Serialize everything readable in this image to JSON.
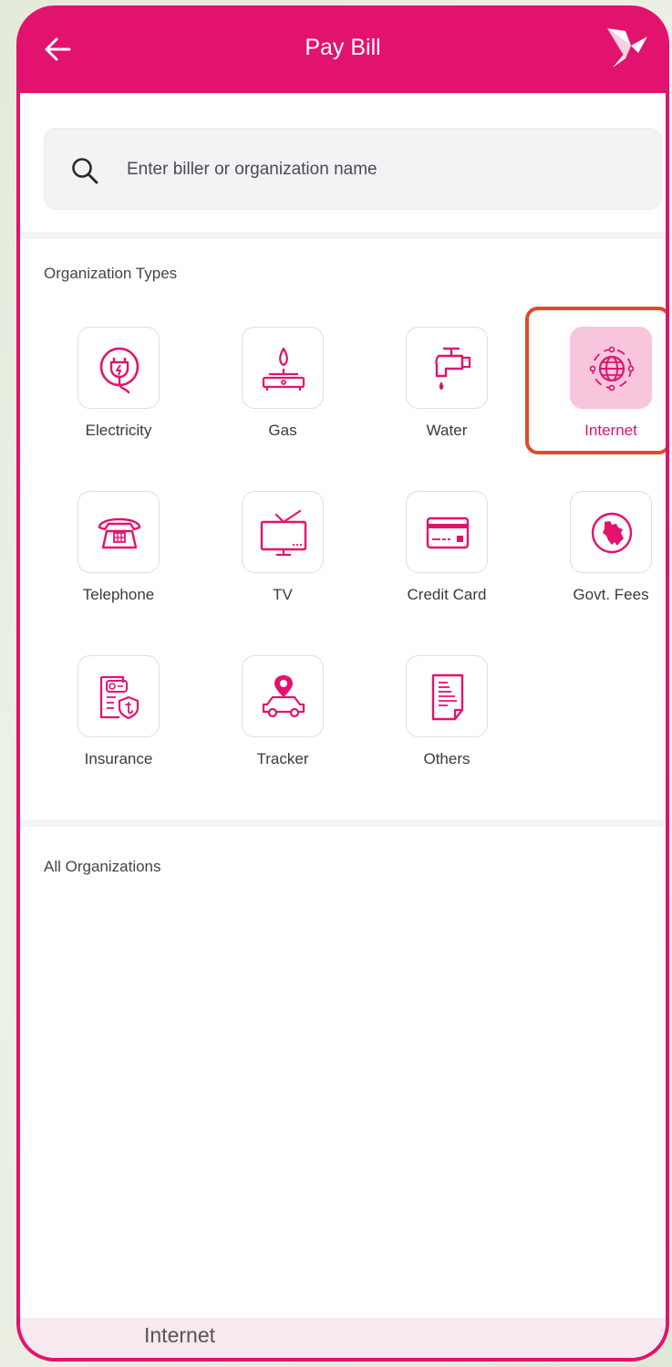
{
  "app": {
    "title": "Pay Bill",
    "brand_color": "#e2136e"
  },
  "search": {
    "placeholder": "Enter biller or organization name",
    "value": ""
  },
  "org_types": {
    "title": "Organization Types",
    "items": [
      {
        "label": "Electricity",
        "icon": "electricity-plug-icon"
      },
      {
        "label": "Gas",
        "icon": "gas-stove-icon"
      },
      {
        "label": "Water",
        "icon": "water-tap-icon"
      },
      {
        "label": "Internet",
        "icon": "globe-icon",
        "selected": true
      },
      {
        "label": "Telephone",
        "icon": "telephone-icon"
      },
      {
        "label": "TV",
        "icon": "tv-icon"
      },
      {
        "label": "Credit Card",
        "icon": "credit-card-icon"
      },
      {
        "label": "Govt. Fees",
        "icon": "bangladesh-map-icon"
      },
      {
        "label": "Insurance",
        "icon": "insurance-shield-icon"
      },
      {
        "label": "Tracker",
        "icon": "car-location-icon"
      },
      {
        "label": "Others",
        "icon": "document-icon"
      }
    ]
  },
  "all_orgs": {
    "title": "All Organizations",
    "first_item": "Internet"
  },
  "highlight_color": "#e04a2a"
}
